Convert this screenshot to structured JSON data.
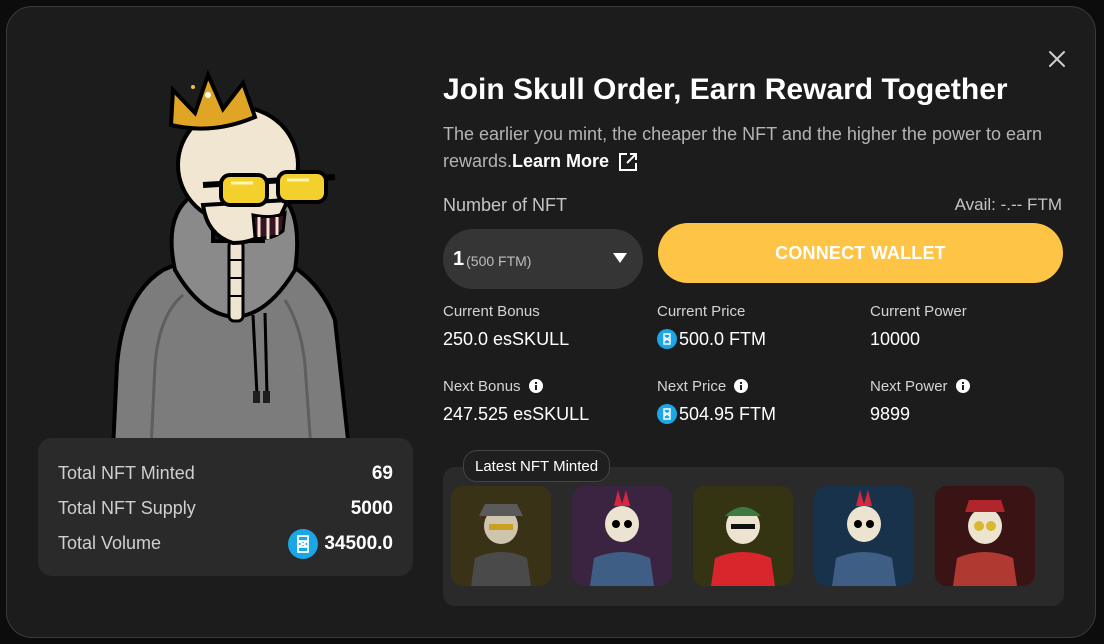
{
  "title": "Join Skull Order, Earn Reward Together",
  "subtitle": "The earlier you mint, the cheaper the NFT and the higher the power to earn rewards.",
  "learn_more": "Learn More",
  "number_label": "Number of NFT",
  "avail": "Avail: -.-- FTM",
  "select": {
    "qty": "1",
    "price": "(500 FTM)"
  },
  "connect_label": "CONNECT WALLET",
  "metrics": {
    "current_bonus_label": "Current Bonus",
    "current_bonus": "250.0 esSKULL",
    "current_price_label": "Current Price",
    "current_price": "500.0 FTM",
    "current_power_label": "Current Power",
    "current_power": "10000",
    "next_bonus_label": "Next Bonus",
    "next_bonus": "247.525 esSKULL",
    "next_price_label": "Next Price",
    "next_price": "504.95 FTM",
    "next_power_label": "Next Power",
    "next_power": "9899"
  },
  "stats": {
    "minted_label": "Total NFT Minted",
    "minted": "69",
    "supply_label": "Total NFT Supply",
    "supply": "5000",
    "volume_label": "Total Volume",
    "volume": "34500.0"
  },
  "latest_label": "Latest NFT Minted",
  "colors": {
    "accent": "#fdc445",
    "ftm_blue": "#1ba6e6",
    "panel": "#1c1c1c",
    "card": "#2a2a2a"
  },
  "thumb_backgrounds": [
    "#3a3216",
    "#3b2342",
    "#343413",
    "#17324a",
    "#3a1314"
  ]
}
